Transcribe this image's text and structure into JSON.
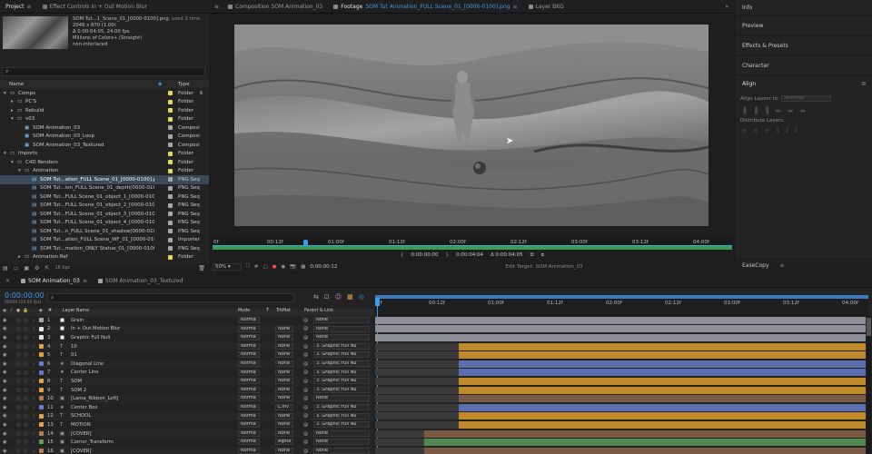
{
  "project": {
    "tab_label": "Project",
    "effect_controls_tab": "Effect Controls In + Out Motion Blur",
    "preview_info": {
      "name": "SOM Tut...1_Scene_01_[0000-0100].png",
      "used": ", used 1 time",
      "dims": "2048 x 870 (1.00)",
      "duration": "Δ 0:00:04:05, 24.00 fps",
      "colors": "Millions of Colors+ (Straight)",
      "interlace": "non-interlaced"
    },
    "search_placeholder": "",
    "col_name": "Name",
    "col_type": "Type",
    "items": [
      {
        "indent": 0,
        "toggle": "▾",
        "icon": "folder",
        "name": "Comps",
        "color": "#e8d65a",
        "type": "Folder",
        "sel": false
      },
      {
        "indent": 1,
        "toggle": "▸",
        "icon": "folder",
        "name": "PC'S",
        "color": "#e8d65a",
        "type": "Folder",
        "sel": false
      },
      {
        "indent": 1,
        "toggle": "▸",
        "icon": "folder",
        "name": "Rebuild",
        "color": "#e8d65a",
        "type": "Folder",
        "sel": false
      },
      {
        "indent": 1,
        "toggle": "▾",
        "icon": "folder",
        "name": "v03",
        "color": "#e8d65a",
        "type": "Folder",
        "sel": false
      },
      {
        "indent": 2,
        "toggle": "",
        "icon": "comp",
        "name": "SOM Animation_03",
        "color": "#a6a6a6",
        "type": "Composi",
        "sel": false
      },
      {
        "indent": 2,
        "toggle": "",
        "icon": "comp",
        "name": "SOM Animation_03_Loop",
        "color": "#a6a6a6",
        "type": "Composi",
        "sel": false
      },
      {
        "indent": 2,
        "toggle": "",
        "icon": "comp",
        "name": "SOM Animation_03_Textured",
        "color": "#a6a6a6",
        "type": "Composi",
        "sel": false
      },
      {
        "indent": 0,
        "toggle": "▾",
        "icon": "folder",
        "name": "Imports",
        "color": "#e8d65a",
        "type": "Folder",
        "sel": false
      },
      {
        "indent": 1,
        "toggle": "▾",
        "icon": "folder",
        "name": "C4D Renders",
        "color": "#e8d65a",
        "type": "Folder",
        "sel": false
      },
      {
        "indent": 2,
        "toggle": "▾",
        "icon": "folder",
        "name": "Animation",
        "color": "#e8d65a",
        "type": "Folder",
        "sel": false
      },
      {
        "indent": 3,
        "toggle": "",
        "icon": "footage",
        "name": "SOM Tut...ation_FULL Scene_01_[0000-0100].png",
        "color": "#a6a6a6",
        "type": "PNG Seq",
        "sel": true
      },
      {
        "indent": 3,
        "toggle": "",
        "icon": "footage",
        "name": "SOM Tut...ion_FULL Scene_01_depth[0000-0100].png",
        "color": "#a6a6a6",
        "type": "PNG Seq",
        "sel": false
      },
      {
        "indent": 3,
        "toggle": "",
        "icon": "footage",
        "name": "SOM Tut...FULL Scene_01_object_1_[0000-0100].png",
        "color": "#a6a6a6",
        "type": "PNG Seq",
        "sel": false
      },
      {
        "indent": 3,
        "toggle": "",
        "icon": "footage",
        "name": "SOM Tut...FULL Scene_01_object_2_[0000-0100].png",
        "color": "#a6a6a6",
        "type": "PNG Seq",
        "sel": false
      },
      {
        "indent": 3,
        "toggle": "",
        "icon": "footage",
        "name": "SOM Tut...FULL Scene_01_object_3_[0000-0100].png",
        "color": "#a6a6a6",
        "type": "PNG Seq",
        "sel": false
      },
      {
        "indent": 3,
        "toggle": "",
        "icon": "footage",
        "name": "SOM Tut...FULL Scene_01_object_4_[0000-0100].png",
        "color": "#a6a6a6",
        "type": "PNG Seq",
        "sel": false
      },
      {
        "indent": 3,
        "toggle": "",
        "icon": "footage",
        "name": "SOM Tut...n_FULL Scene_01_shadow[0000-0100].png",
        "color": "#a6a6a6",
        "type": "PNG Seq",
        "sel": false
      },
      {
        "indent": 3,
        "toggle": "",
        "icon": "footage",
        "name": "SOM Tut...ation_FULL Scene_WF_01_[0000-0100].jpg",
        "color": "#a6a6a6",
        "type": "Importer",
        "sel": false
      },
      {
        "indent": 3,
        "toggle": "",
        "icon": "footage",
        "name": "SOM Tut...mation_ONLY Statue_01_[0000-0100].png",
        "color": "#a6a6a6",
        "type": "PNG Seq",
        "sel": false
      },
      {
        "indent": 2,
        "toggle": "▸",
        "icon": "folder",
        "name": "Animation Ref",
        "color": "#e8d65a",
        "type": "Folder",
        "sel": false
      }
    ],
    "bpc": "16 bpc"
  },
  "viewer": {
    "tabs": [
      {
        "label": "Composition SOM Animation_03",
        "active": false
      },
      {
        "label": "Footage",
        "active": true
      },
      {
        "label": "SOM Tut Animation_FULL Scene_01_[0000-0100].png",
        "active": true
      },
      {
        "label": "Layer BKG",
        "active": false
      }
    ],
    "ruler_labels": [
      "0f",
      "00:12f",
      "01:00f",
      "01:12f",
      "02:00f",
      "02:12f",
      "03:00f",
      "03:12f",
      "04:00f"
    ],
    "in_time": "0:00:00:00",
    "out_time": "0:00:04:04",
    "dur_time": "Δ 0:00:04:05",
    "zoom": "50%",
    "current_time": "0:00:00:12",
    "edit_target": "Edit Target: SOM Animation_03"
  },
  "right": {
    "panels": [
      "Info",
      "Preview",
      "Effects & Presets",
      "Character"
    ],
    "align_title": "Align",
    "align_layers_to": "Align Layers to:",
    "align_dropdown": "Selection",
    "distribute_layers": "Distribute Layers:",
    "easecopy": "EaseCopy"
  },
  "timeline": {
    "tabs": [
      {
        "label": "SOM Animation_03",
        "active": true,
        "color": "#a6a6a6"
      },
      {
        "label": "SOM Animation_03_Textured",
        "active": false,
        "color": "#a6a6a6"
      }
    ],
    "current_time": "0:00:00:00",
    "fps_info": "00000 (24.00 fps)",
    "col_hash": "#",
    "col_layer_name": "Layer Name",
    "col_mode": "Mode",
    "col_t": "T",
    "col_trkmat": "TrkMat",
    "col_parent": "Parent & Link",
    "ruler_labels": [
      "0f",
      "00:12f",
      "01:00f",
      "01:12f",
      "02:00f",
      "02:12f",
      "03:00f",
      "03:12f",
      "04:00f"
    ],
    "layers": [
      {
        "num": "1",
        "color": "#a6a6a6",
        "type": "solid",
        "name": "Grain",
        "mode": "Norma",
        "trk": "",
        "parent": "None",
        "bar_color": "#8e8e96",
        "start": 0.0
      },
      {
        "num": "2",
        "color": "#e6e6e6",
        "type": "solid",
        "name": "In + Out Motion Blur",
        "mode": "Norma",
        "trk": "None",
        "parent": "None",
        "bar_color": "#8e8e96",
        "start": 0.0
      },
      {
        "num": "3",
        "color": "#e6e6e6",
        "type": "solid",
        "name": "Graphic Full Null",
        "mode": "Norma",
        "trk": "None",
        "parent": "None",
        "bar_color": "#8e8e96",
        "start": 0.0
      },
      {
        "num": "4",
        "color": "#e8a341",
        "type": "text",
        "name": "10",
        "mode": "Norma",
        "trk": "None",
        "parent": "3. Graphic Full Nu",
        "bar_color": "#c08a2c",
        "start": 0.17
      },
      {
        "num": "5",
        "color": "#e8a341",
        "type": "text",
        "name": "01",
        "mode": "Norma",
        "trk": "None",
        "parent": "3. Graphic Full Nu",
        "bar_color": "#c08a2c",
        "start": 0.17
      },
      {
        "num": "6",
        "color": "#6a7ad0",
        "type": "shape",
        "name": "Diagonal Line",
        "mode": "Norma",
        "trk": "None",
        "parent": "3. Graphic Full Nu",
        "bar_color": "#5c6fb0",
        "start": 0.17
      },
      {
        "num": "7",
        "color": "#6a7ad0",
        "type": "shape",
        "name": "Center Line",
        "mode": "Norma",
        "trk": "None",
        "parent": "3. Graphic Full Nu",
        "bar_color": "#5c6fb0",
        "start": 0.17
      },
      {
        "num": "8",
        "color": "#e8a341",
        "type": "text",
        "name": "SOM",
        "mode": "Norma",
        "trk": "None",
        "parent": "3. Graphic Full Nu",
        "bar_color": "#c08a2c",
        "start": 0.17
      },
      {
        "num": "9",
        "color": "#e8a341",
        "type": "text",
        "name": "SOM 2",
        "mode": "Norma",
        "trk": "None",
        "parent": "3. Graphic Full Nu",
        "bar_color": "#c08a2c",
        "start": 0.17
      },
      {
        "num": "10",
        "color": "#b87c52",
        "type": "comp",
        "name": "[Lama_Ribbon_Left]",
        "mode": "Norma",
        "trk": "None",
        "parent": "None",
        "bar_color": "#7a5a44",
        "start": 0.17
      },
      {
        "num": "11",
        "color": "#6a7ad0",
        "type": "shape",
        "name": "Center Box",
        "mode": "Norma",
        "trk": "L.Inv",
        "parent": "3. Graphic Full Nu",
        "bar_color": "#5c6fb0",
        "start": 0.17
      },
      {
        "num": "12",
        "color": "#e8a341",
        "type": "text",
        "name": "SCHOOL",
        "mode": "Norma",
        "trk": "None",
        "parent": "3. Graphic Full Nu",
        "bar_color": "#c08a2c",
        "start": 0.17
      },
      {
        "num": "13",
        "color": "#e8a341",
        "type": "text",
        "name": "MOTION",
        "mode": "Norma",
        "trk": "None",
        "parent": "3. Graphic Full Nu",
        "bar_color": "#c08a2c",
        "start": 0.17
      },
      {
        "num": "14",
        "color": "#b87c52",
        "type": "comp",
        "name": "[COVER]",
        "mode": "Norma",
        "trk": "None",
        "parent": "None",
        "bar_color": "#7a5a44",
        "start": 0.1
      },
      {
        "num": "15",
        "color": "#5aa35a",
        "type": "comp",
        "name": "Corner_Transform",
        "mode": "Norma",
        "trk": "Alpha",
        "parent": "None",
        "bar_color": "#4f8a4f",
        "start": 0.1
      },
      {
        "num": "16",
        "color": "#b87c52",
        "type": "comp",
        "name": "[COVER]",
        "mode": "Norma",
        "trk": "None",
        "parent": "None",
        "bar_color": "#7a5a44",
        "start": 0.1
      },
      {
        "num": "17",
        "color": "#5aa35a",
        "type": "comp",
        "name": "Corner_Blur",
        "mode": "Norma",
        "trk": "Alpha",
        "parent": "None",
        "bar_color": "#4f8a4f",
        "start": 0.1
      }
    ]
  }
}
